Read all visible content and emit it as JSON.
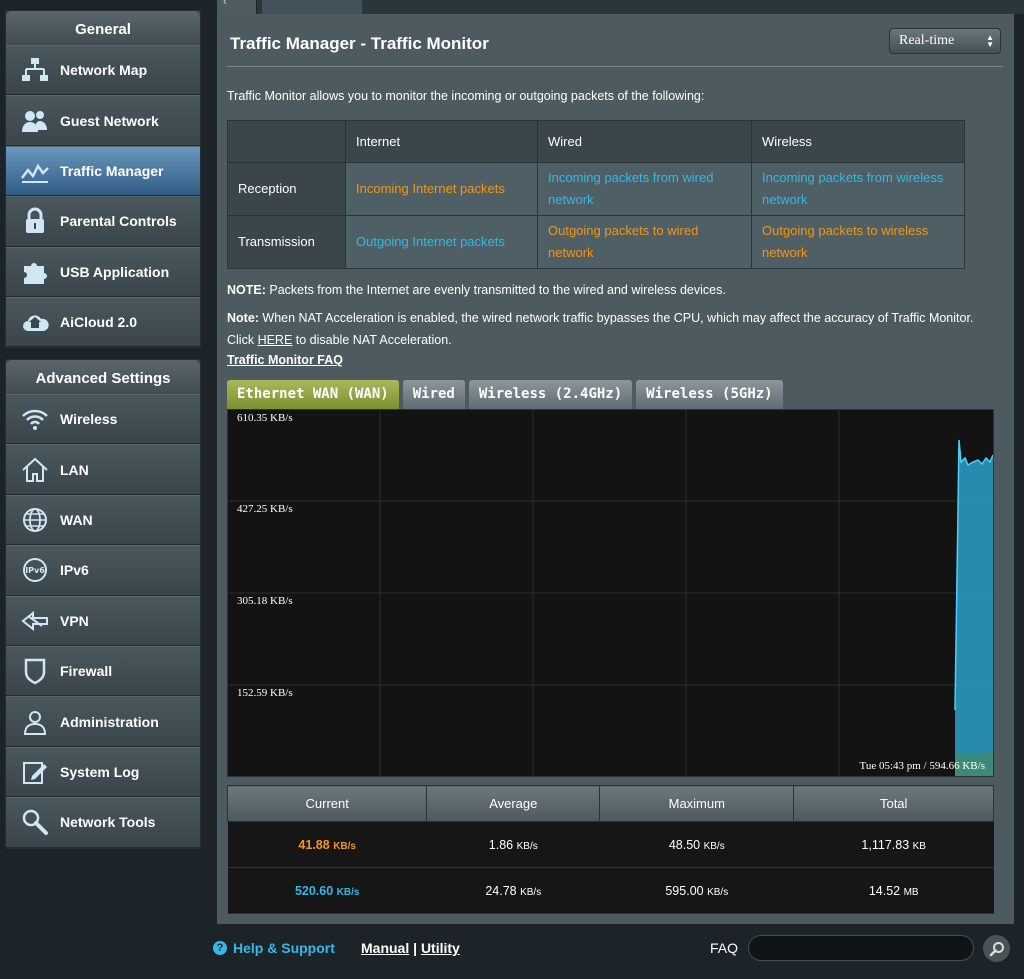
{
  "sidebar": {
    "general_title": "General",
    "general_items": [
      {
        "label": "Network Map",
        "icon": "network-map-icon"
      },
      {
        "label": "Guest Network",
        "icon": "guest-network-icon"
      },
      {
        "label": "Traffic Manager",
        "icon": "traffic-manager-icon",
        "active": true
      },
      {
        "label": "Parental Controls",
        "icon": "lock-icon"
      },
      {
        "label": "USB Application",
        "icon": "puzzle-icon"
      },
      {
        "label": "AiCloud 2.0",
        "icon": "cloud-icon"
      }
    ],
    "advanced_title": "Advanced Settings",
    "advanced_items": [
      {
        "label": "Wireless",
        "icon": "wifi-icon"
      },
      {
        "label": "LAN",
        "icon": "home-icon"
      },
      {
        "label": "WAN",
        "icon": "globe-icon"
      },
      {
        "label": "IPv6",
        "icon": "ipv6-icon"
      },
      {
        "label": "VPN",
        "icon": "vpn-icon"
      },
      {
        "label": "Firewall",
        "icon": "shield-icon"
      },
      {
        "label": "Administration",
        "icon": "user-icon"
      },
      {
        "label": "System Log",
        "icon": "edit-icon"
      },
      {
        "label": "Network Tools",
        "icon": "tools-icon"
      }
    ]
  },
  "main": {
    "title": "Traffic Manager - Traffic Monitor",
    "mode_select": "Real-time",
    "description": "Traffic Monitor allows you to monitor the incoming or outgoing packets of the following:",
    "table": {
      "headers": [
        "",
        "Internet",
        "Wired",
        "Wireless"
      ],
      "rows": [
        {
          "label": "Reception",
          "cells": [
            "Incoming Internet packets",
            "Incoming packets from wired network",
            "Incoming packets from wireless network"
          ]
        },
        {
          "label": "Transmission",
          "cells": [
            "Outgoing Internet packets",
            "Outgoing packets to wired network",
            "Outgoing packets to wireless network"
          ]
        }
      ]
    },
    "note1_label": "NOTE:",
    "note1_text": " Packets from the Internet are evenly transmitted to the wired and wireless devices.",
    "note2_label": "Note:",
    "note2_text": " When NAT Acceleration is enabled, the wired network traffic bypasses the CPU, which may affect the accuracy of Traffic Monitor.",
    "note2_click": "Click ",
    "note2_link": "HERE",
    "note2_tail": " to disable NAT Acceleration.",
    "faq_link": "Traffic Monitor FAQ",
    "tabs": [
      "Ethernet WAN (WAN)",
      "Wired",
      "Wireless (2.4GHz)",
      "Wireless (5GHz)"
    ],
    "graph": {
      "y_labels": [
        "610.35 KB/s",
        "427.25 KB/s",
        "305.18 KB/s",
        "152.59 KB/s"
      ],
      "timestamp": "Tue 05:43 pm / 594.66 KB/s",
      "colors": {
        "received": "#2aa1c9",
        "sent": "#3f8a72"
      }
    },
    "stats": {
      "headers": [
        "Current",
        "Average",
        "Maximum",
        "Total"
      ],
      "rows": [
        {
          "current": "41.88",
          "current_unit": "KB/s",
          "average": "1.86",
          "average_unit": "KB/s",
          "maximum": "48.50",
          "maximum_unit": "KB/s",
          "total": "1,117.83",
          "total_unit": "KB"
        },
        {
          "current": "520.60",
          "current_unit": "KB/s",
          "average": "24.78",
          "average_unit": "KB/s",
          "maximum": "595.00",
          "maximum_unit": "KB/s",
          "total": "14.52",
          "total_unit": "MB"
        }
      ]
    }
  },
  "footer": {
    "help": "Help & Support",
    "manual": "Manual",
    "separator": "|",
    "utility": "Utility",
    "faq_label": "FAQ",
    "faq_value": ""
  }
}
